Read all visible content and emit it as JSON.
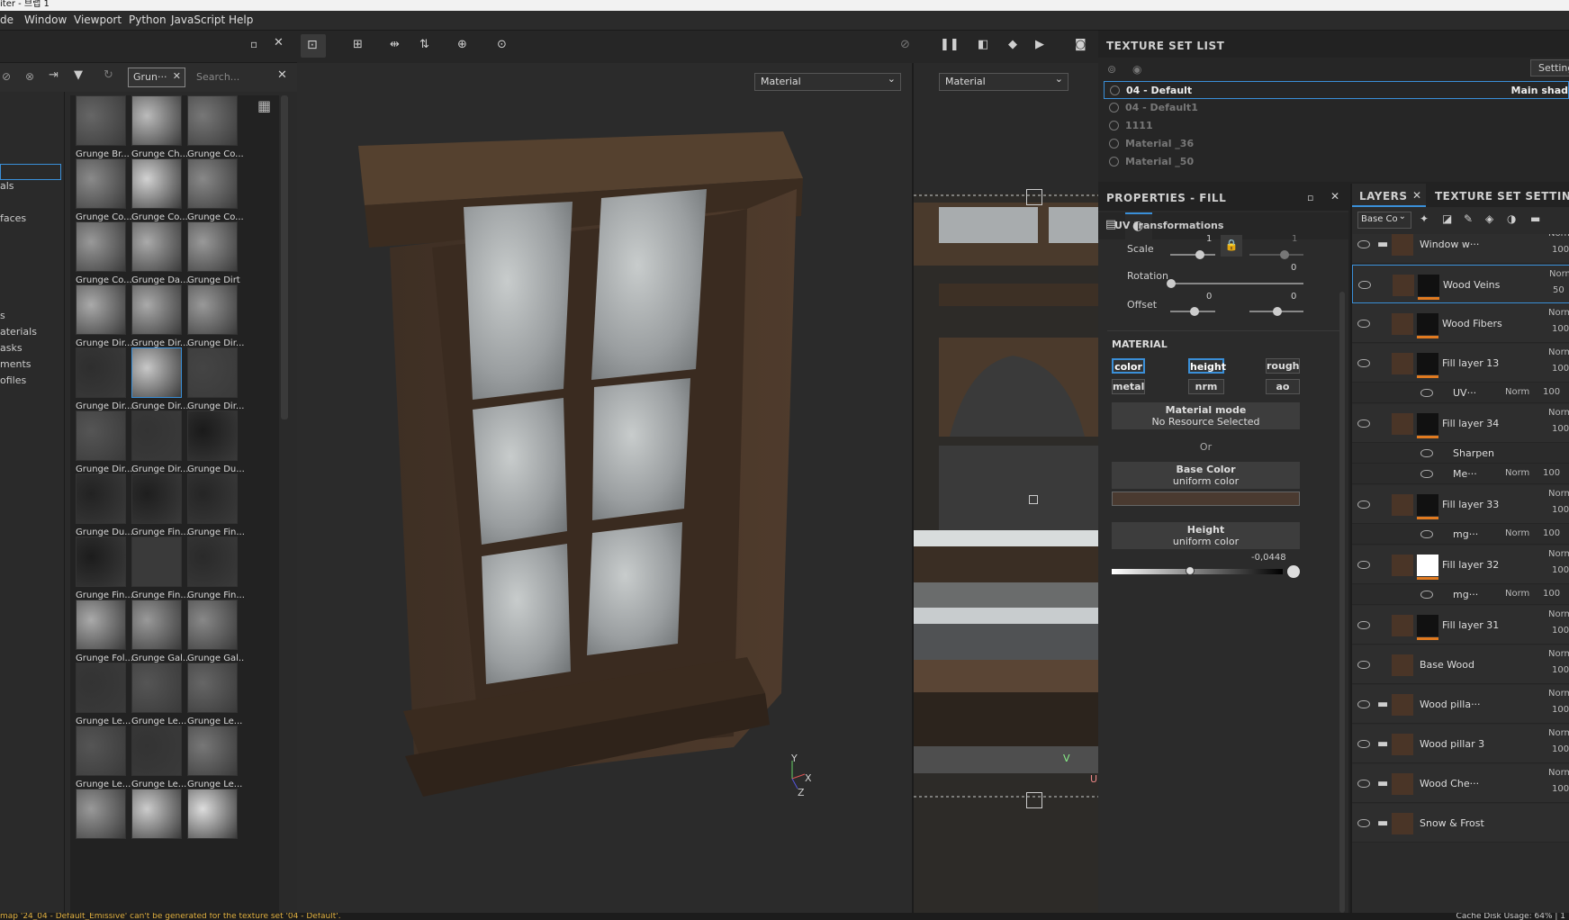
{
  "window": {
    "title_partial": "iter - 브랩 1"
  },
  "menu": [
    "de",
    "Window",
    "Viewport",
    "Python",
    "JavaScript",
    "Help"
  ],
  "shelf": {
    "filter_chip": "Grun···",
    "search_placeholder": "Search...",
    "left_items": [
      "als",
      "faces",
      "s",
      "aterials",
      "asks",
      "ments",
      "ofiles"
    ],
    "tiles": [
      "Grunge Br...",
      "Grunge Ch...",
      "Grunge Co...",
      "Grunge Co...",
      "Grunge Co...",
      "Grunge Co...",
      "Grunge Co...",
      "Grunge Da...",
      "Grunge Dirt",
      "Grunge Dir...",
      "Grunge Dir...",
      "Grunge Dir...",
      "Grunge Dir...",
      "Grunge Dir...",
      "Grunge Dir...",
      "Grunge Dir...",
      "Grunge Dir...",
      "Grunge Du...",
      "Grunge Du...",
      "Grunge Fin...",
      "Grunge Fin...",
      "Grunge Fin...",
      "Grunge Fin...",
      "Grunge Fin...",
      "Grunge Fol...",
      "Grunge Gal...",
      "Grunge Gal...",
      "Grunge Le...",
      "Grunge Le...",
      "Grunge Le...",
      "Grunge Le...",
      "Grunge Le...",
      "Grunge Le...",
      "",
      "",
      ""
    ],
    "tile_tones": [
      "#666",
      "#bbb",
      "#777",
      "#8a8a8a",
      "#d2d2d2",
      "#888",
      "#999",
      "#aaa",
      "#999",
      "#aaa",
      "#aaa",
      "#999",
      "#2e2e2e",
      "#c8c8c8",
      "#444",
      "#555",
      "#333",
      "#1a1a1a",
      "#222",
      "#1e1e1e",
      "#252525",
      "#1c1c1c",
      "#3a3a3a",
      "#2a2a2a",
      "#aaa",
      "#999",
      "#888",
      "#333",
      "#555",
      "#666",
      "#555",
      "#333",
      "#777",
      "#999",
      "#ccc",
      "#ddd"
    ]
  },
  "viewport": {
    "left_mode": "Material",
    "right_mode": "Material",
    "axis_y": "Y",
    "axis_x": "X",
    "axis_z": "Z",
    "uv_v": "V",
    "uv_u": "U"
  },
  "texture_set_list": {
    "title": "TEXTURE SET LIST",
    "settings": "Setting",
    "items": [
      {
        "name": "04 - Default",
        "shader": "Main shad",
        "active": true
      },
      {
        "name": "04 - Default1",
        "shader": "",
        "active": false
      },
      {
        "name": "1111",
        "shader": "",
        "active": false
      },
      {
        "name": "Material _36",
        "shader": "",
        "active": false
      },
      {
        "name": "Material _50",
        "shader": "",
        "active": false
      }
    ]
  },
  "properties": {
    "title": "PROPERTIES - FILL",
    "uv_section": "UV transformations",
    "scale_label": "Scale",
    "scale_a": "1",
    "scale_b": "1",
    "rotation_label": "Rotation",
    "rotation_value": "0",
    "offset_label": "Offset",
    "offset_a": "0",
    "offset_b": "0",
    "material_header": "MATERIAL",
    "channels": [
      "color",
      "height",
      "rough",
      "metal",
      "nrm",
      "ao"
    ],
    "material_mode": "Material mode",
    "no_resource": "No Resource Selected",
    "or": "Or",
    "base_color": "Base Color",
    "base_color_sub": "uniform color",
    "base_color_hex": "#4a3a30",
    "height": "Height",
    "height_sub": "uniform color",
    "height_value": "-0,0448",
    "height_fraction": 0.46
  },
  "layers": {
    "tab_layers": "LAYERS",
    "tab_tss": "TEXTURE SET SETTIN",
    "channel_select": "Base Co",
    "rows": [
      {
        "name": "Window w···",
        "blend": "Norm",
        "opacity": "100",
        "kind": "folder"
      },
      {
        "name": "Wood Veins",
        "blend": "Norm",
        "opacity": "50",
        "kind": "fill",
        "selected": true
      },
      {
        "name": "Wood Fibers",
        "blend": "Norm",
        "opacity": "100",
        "kind": "fill"
      },
      {
        "name": "Fill layer 13",
        "blend": "Norm",
        "opacity": "100",
        "kind": "fill"
      },
      {
        "name": "UV···",
        "blend": "Norm",
        "opacity": "100",
        "kind": "sub"
      },
      {
        "name": "Fill layer 34",
        "blend": "Norm",
        "opacity": "100",
        "kind": "fill"
      },
      {
        "name": "Sharpen",
        "blend": "",
        "opacity": "",
        "kind": "sub"
      },
      {
        "name": "Me···",
        "blend": "Norm",
        "opacity": "100",
        "kind": "sub"
      },
      {
        "name": "Fill layer 33",
        "blend": "Norm",
        "opacity": "100",
        "kind": "fill"
      },
      {
        "name": "mg···",
        "blend": "Norm",
        "opacity": "100",
        "kind": "sub"
      },
      {
        "name": "Fill layer 32",
        "blend": "Norm",
        "opacity": "100",
        "kind": "fill"
      },
      {
        "name": "mg···",
        "blend": "Norm",
        "opacity": "100",
        "kind": "sub"
      },
      {
        "name": "Fill layer 31",
        "blend": "Norm",
        "opacity": "100",
        "kind": "fill"
      },
      {
        "name": "Base Wood",
        "blend": "Norm",
        "opacity": "100",
        "kind": "fill"
      },
      {
        "name": "Wood pilla···",
        "blend": "Norm",
        "opacity": "100",
        "kind": "folder"
      },
      {
        "name": "Wood pillar 3",
        "blend": "Norm",
        "opacity": "100",
        "kind": "folder"
      },
      {
        "name": "Wood Che···",
        "blend": "Norm",
        "opacity": "100",
        "kind": "folder"
      },
      {
        "name": "Snow & Frost",
        "blend": "",
        "opacity": "",
        "kind": "folder"
      }
    ]
  },
  "status": {
    "message": "map '24_04 - Default_Emissive' can't be generated for the texture set '04 - Default'.",
    "cache": "Cache Disk Usage:  64% | 1"
  },
  "colors": {
    "accent": "#3a8fd8",
    "orange": "#e07a20",
    "wood": "#4a3527"
  }
}
